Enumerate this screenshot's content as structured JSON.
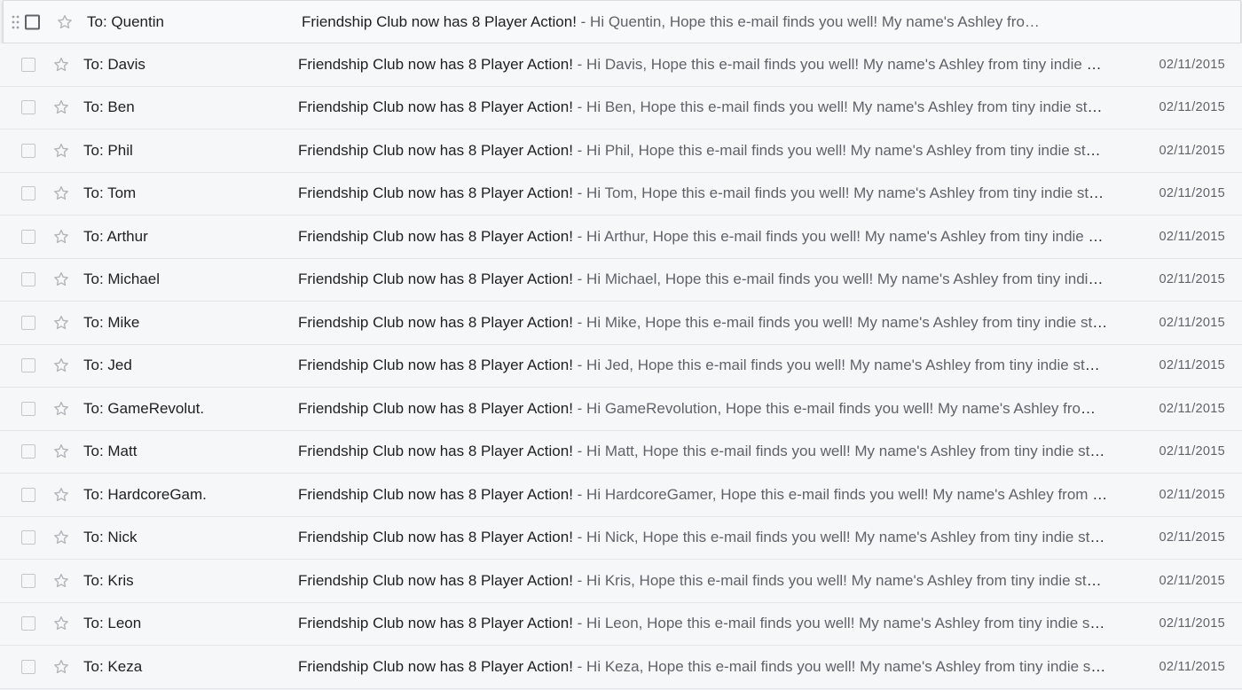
{
  "colors": {
    "row_bg": "#f6f7f9",
    "hover_bg": "#f8f9fa",
    "subject": "#202124",
    "snippet": "#5f6368"
  },
  "icons": {
    "drag": "drag-handle-icon",
    "star": "star-outline-icon"
  },
  "emails": [
    {
      "to": "To: Quentin",
      "subject": "Friendship Club now has 8 Player Action!",
      "snippet": " - Hi Quentin, Hope this e-mail finds you well! My name's Ashley fro…",
      "date": "",
      "hovered": true
    },
    {
      "to": "To: Davis",
      "subject": "Friendship Club now has 8 Player Action!",
      "snippet": " - Hi Davis, Hope this e-mail finds you well! My name's Ashley from tiny indie studio Goodmin Games",
      "date": "02/11/2015"
    },
    {
      "to": "To: Ben",
      "subject": "Friendship Club now has 8 Player Action!",
      "snippet": " - Hi Ben, Hope this e-mail finds you well! My name's Ashley from tiny indie studio Goodmin Games",
      "date": "02/11/2015"
    },
    {
      "to": "To: Phil",
      "subject": "Friendship Club now has 8 Player Action!",
      "snippet": " - Hi Phil, Hope this e-mail finds you well! My name's Ashley from tiny indie studio Goodmin Games",
      "date": "02/11/2015"
    },
    {
      "to": "To: Tom",
      "subject": "Friendship Club now has 8 Player Action!",
      "snippet": " - Hi Tom, Hope this e-mail finds you well! My name's Ashley from tiny indie studio Goodmin Games",
      "date": "02/11/2015"
    },
    {
      "to": "To: Arthur",
      "subject": "Friendship Club now has 8 Player Action!",
      "snippet": " - Hi Arthur, Hope this e-mail finds you well! My name's Ashley from tiny indie studio Goodmin Games",
      "date": "02/11/2015"
    },
    {
      "to": "To: Michael",
      "subject": "Friendship Club now has 8 Player Action!",
      "snippet": " - Hi Michael, Hope this e-mail finds you well! My name's Ashley from tiny indie studio Goodmin Games",
      "date": "02/11/2015"
    },
    {
      "to": "To: Mike",
      "subject": "Friendship Club now has 8 Player Action!",
      "snippet": " - Hi Mike, Hope this e-mail finds you well! My name's Ashley from tiny indie studio Goodmin Games",
      "date": "02/11/2015"
    },
    {
      "to": "To: Jed",
      "subject": "Friendship Club now has 8 Player Action!",
      "snippet": " - Hi Jed, Hope this e-mail finds you well! My name's Ashley from tiny indie studio Goodmin Games",
      "date": "02/11/2015"
    },
    {
      "to": "To: GameRevolut.",
      "subject": "Friendship Club now has 8 Player Action!",
      "snippet": " - Hi GameRevolution, Hope this e-mail finds you well! My name's Ashley from tiny indie studio Goodmin Games",
      "date": "02/11/2015"
    },
    {
      "to": "To: Matt",
      "subject": "Friendship Club now has 8 Player Action!",
      "snippet": " - Hi Matt, Hope this e-mail finds you well! My name's Ashley from tiny indie studio Goodmin Games",
      "date": "02/11/2015"
    },
    {
      "to": "To: HardcoreGam.",
      "subject": "Friendship Club now has 8 Player Action!",
      "snippet": " - Hi HardcoreGamer, Hope this e-mail finds you well! My name's Ashley from tiny indie studio Goodmin Games",
      "date": "02/11/2015"
    },
    {
      "to": "To: Nick",
      "subject": "Friendship Club now has 8 Player Action!",
      "snippet": " - Hi Nick, Hope this e-mail finds you well! My name's Ashley from tiny indie studio Goodmin Games",
      "date": "02/11/2015"
    },
    {
      "to": "To: Kris",
      "subject": "Friendship Club now has 8 Player Action!",
      "snippet": " - Hi Kris, Hope this e-mail finds you well! My name's Ashley from tiny indie studio Goodmin Games",
      "date": "02/11/2015"
    },
    {
      "to": "To: Leon",
      "subject": "Friendship Club now has 8 Player Action!",
      "snippet": " - Hi Leon, Hope this e-mail finds you well! My name's Ashley from tiny indie studio Goodmin Games",
      "date": "02/11/2015"
    },
    {
      "to": "To: Keza",
      "subject": "Friendship Club now has 8 Player Action!",
      "snippet": " - Hi Keza, Hope this e-mail finds you well! My name's Ashley from tiny indie studio Goodmin Games",
      "date": "02/11/2015"
    }
  ]
}
